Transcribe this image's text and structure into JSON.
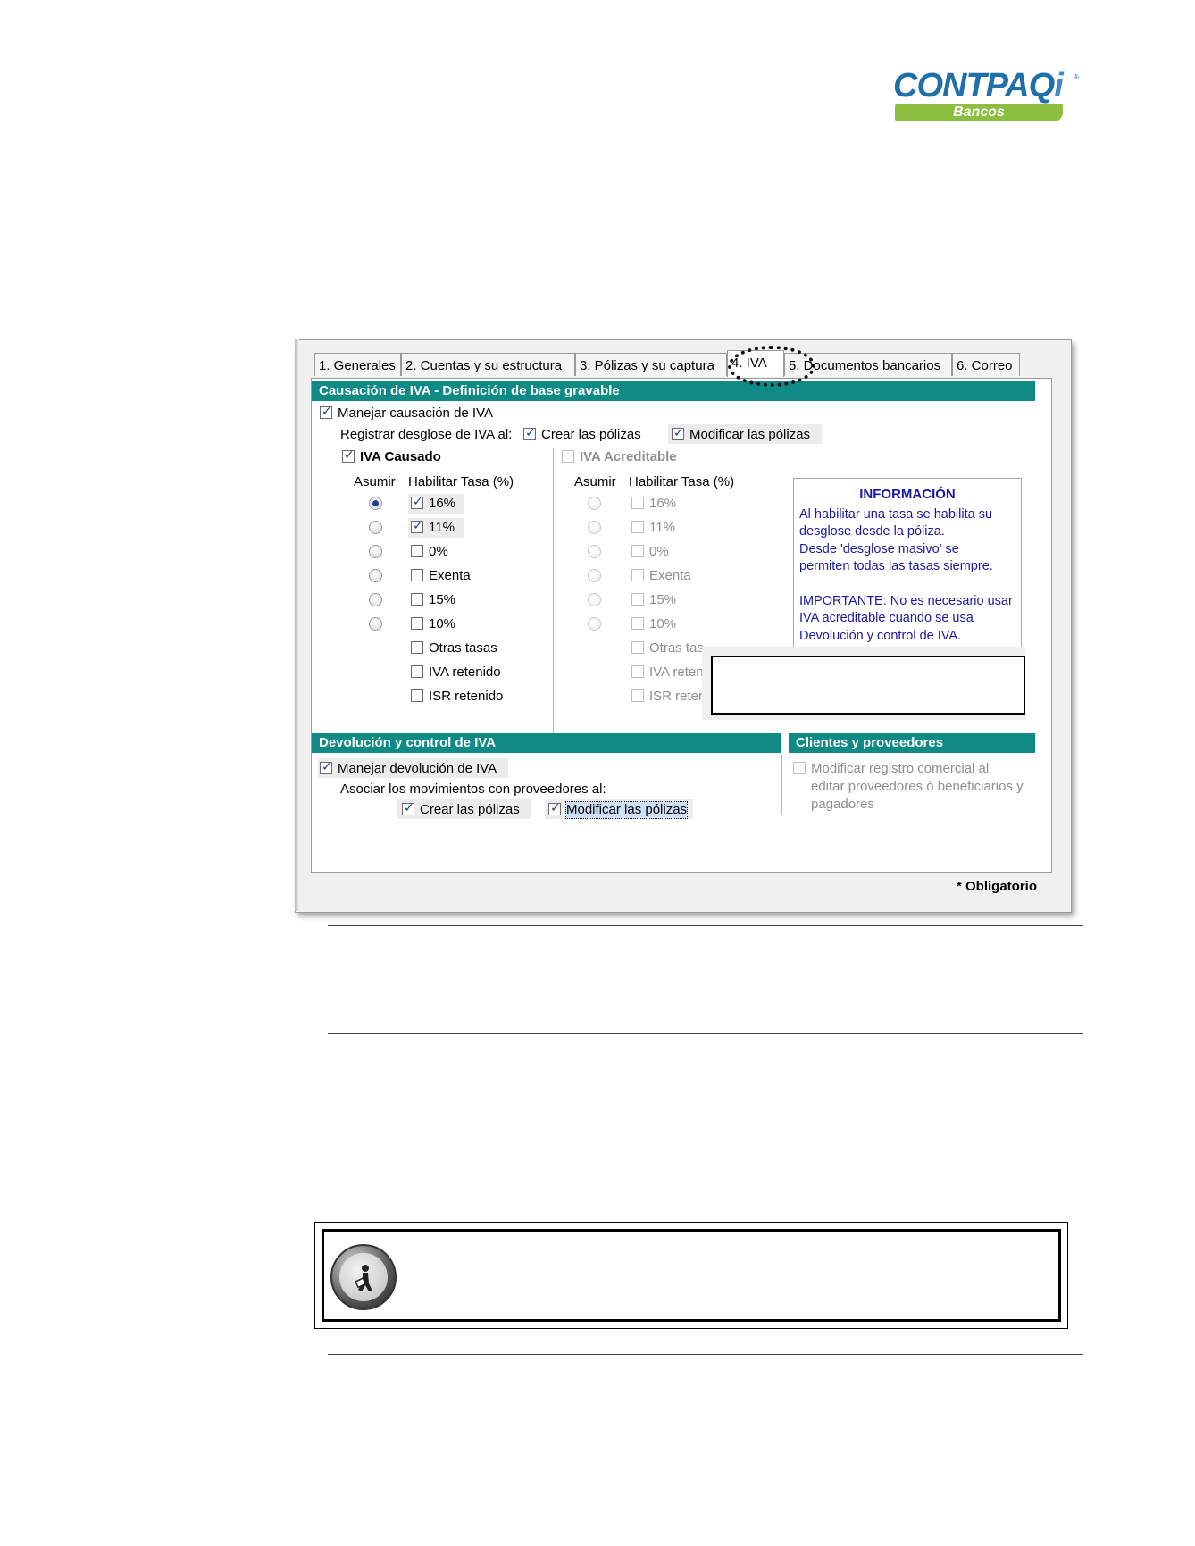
{
  "logo": {
    "main": "CONTPAQ",
    "i": "i",
    "sub": "Bancos",
    "tm": "®"
  },
  "tabs": [
    {
      "label": "1. Generales",
      "active": false
    },
    {
      "label": "2. Cuentas y su estructura",
      "active": false
    },
    {
      "label": "3. Pólizas y su captura",
      "active": false
    },
    {
      "label": "4. IVA",
      "active": true
    },
    {
      "label": "5. Documentos bancarios",
      "active": false
    },
    {
      "label": "6. Correo",
      "active": false
    }
  ],
  "causacion": {
    "header": "Causación de IVA - Definición de base gravable",
    "manejar": {
      "label": "Manejar causación de IVA",
      "checked": true
    },
    "registrar_label": "Registrar desglose de IVA al:",
    "crear": {
      "label": "Crear las pólizas",
      "checked": true
    },
    "modificar": {
      "label": "Modificar las pólizas",
      "checked": true
    },
    "causado": {
      "title": "IVA Causado",
      "checked": true,
      "col_asumir": "Asumir",
      "col_habilitar": "Habilitar Tasa (%)",
      "rates": [
        {
          "label": "16%",
          "checked": true,
          "radio": true,
          "selected": true
        },
        {
          "label": "11%",
          "checked": true,
          "radio": true,
          "selected": false
        },
        {
          "label": "0%",
          "checked": false,
          "radio": true,
          "selected": false
        },
        {
          "label": "Exenta",
          "checked": false,
          "radio": true,
          "selected": false
        },
        {
          "label": "15%",
          "checked": false,
          "radio": true,
          "selected": false
        },
        {
          "label": "10%",
          "checked": false,
          "radio": true,
          "selected": false
        },
        {
          "label": "Otras tasas",
          "checked": false,
          "radio": false
        },
        {
          "label": "IVA retenido",
          "checked": false,
          "radio": false
        },
        {
          "label": "ISR retenido",
          "checked": false,
          "radio": false
        }
      ]
    },
    "acreditable": {
      "title": "IVA Acreditable",
      "checked": false,
      "col_asumir": "Asumir",
      "col_habilitar": "Habilitar Tasa (%)",
      "rates": [
        {
          "label": "16%",
          "radio": true
        },
        {
          "label": "11%",
          "radio": true
        },
        {
          "label": "0%",
          "radio": true
        },
        {
          "label": "Exenta",
          "radio": true
        },
        {
          "label": "15%",
          "radio": true
        },
        {
          "label": "10%",
          "radio": true
        },
        {
          "label": "Otras tas",
          "radio": false
        },
        {
          "label": "IVA reten",
          "radio": false
        },
        {
          "label": "ISR retenido",
          "radio": false
        }
      ]
    },
    "info": {
      "title": "INFORMACIÓN",
      "p1": "Al habilitar una tasa se habilita su\ndesglose desde la póliza.\nDesde 'desglose masivo' se\npermiten todas las tasas siempre.",
      "p2": "IMPORTANTE: No es necesario usar\nIVA acreditable cuando se usa\nDevolución y control de IVA."
    }
  },
  "devolucion": {
    "header": "Devolución y control de IVA",
    "manejar": {
      "label": "Manejar devolución de IVA",
      "checked": true
    },
    "asociar_label": "Asociar los movimientos con proveedores al:",
    "crear": {
      "label": "Crear las pólizas",
      "checked": true
    },
    "modificar": {
      "label": "Modificar las pólizas",
      "checked": true
    }
  },
  "clientes": {
    "header": "Clientes y proveedores",
    "modificar": {
      "label": "Modificar registro comercial al",
      "line2": "editar proveedores ó beneficiarios y",
      "line3": "pagadores",
      "checked": false
    }
  },
  "footer": {
    "obligatorio": "* Obligatorio"
  },
  "colors": {
    "section_header": "#0f8a84",
    "info_text": "#1a1aa0",
    "logo_blue": "#1f6fa8",
    "logo_green": "#8cbf3f"
  }
}
